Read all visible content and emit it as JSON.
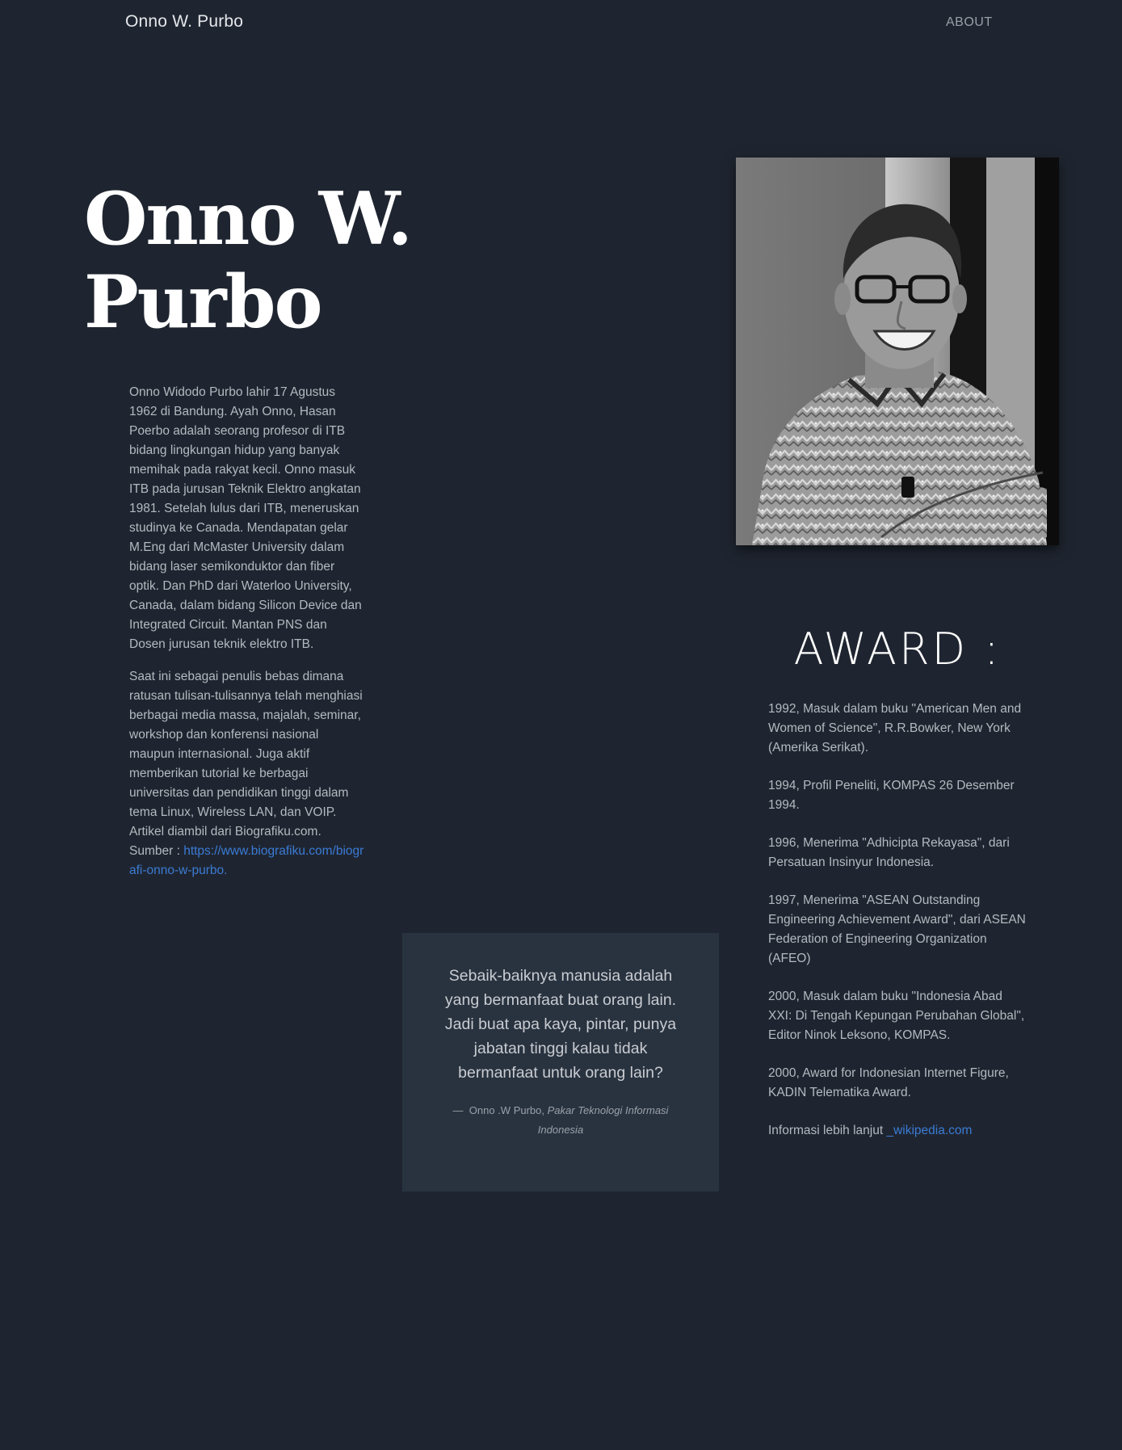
{
  "nav": {
    "brand": "Onno W. Purbo",
    "about": "ABOUT"
  },
  "hero": {
    "title_line1": "Onno W.",
    "title_line2": "Purbo"
  },
  "bio": {
    "paragraph1": "Onno Widodo Purbo lahir 17 Agustus 1962 di Bandung. Ayah Onno, Hasan Poerbo adalah seorang profesor di ITB bidang lingkungan hidup yang banyak memihak pada rakyat kecil. Onno masuk ITB pada jurusan Teknik Elektro angkatan 1981. Setelah lulus dari ITB, meneruskan studinya ke Canada. Mendapatan gelar M.Eng dari McMaster University dalam bidang laser semikonduktor dan fiber optik. Dan PhD dari Waterloo University, Canada, dalam bidang Silicon Device dan Integrated Circuit. Mantan PNS dan Dosen jurusan teknik elektro ITB.",
    "paragraph2": "Saat ini sebagai penulis bebas dimana ratusan tulisan-tulisannya telah menghiasi berbagai media massa, majalah, seminar, workshop dan konferensi nasional maupun internasional. Juga aktif memberikan tutorial ke berbagai universitas dan pendidikan tinggi dalam tema Linux, Wireless LAN, dan VOIP. Artikel diambil dari Biografiku.com. Sumber :",
    "source_link": "https://www.biografiku.com/biografi-onno-w-purbo."
  },
  "quote": {
    "text": "Sebaik-baiknya manusia adalah yang bermanfaat buat orang lain. Jadi buat apa kaya, pintar, punya jabatan tinggi kalau tidak bermanfaat untuk orang lain?",
    "dash": "—",
    "author": "Onno .W Purbo,",
    "role": "Pakar Teknologi Informasi Indonesia"
  },
  "award": {
    "title": "AWARD :",
    "items": [
      "1992, Masuk dalam buku \"American Men and Women of Science\", R.R.Bowker, New York (Amerika Serikat).",
      "1994, Profil Peneliti, KOMPAS 26 Desember 1994.",
      "1996, Menerima \"Adhicipta Rekayasa\", dari Persatuan Insinyur Indonesia.",
      "1997, Menerima \"ASEAN Outstanding Engineering Achievement Award\", dari ASEAN Federation of Engineering Organization (AFEO)",
      "2000, Masuk dalam buku \"Indonesia Abad XXI: Di Tengah Kepungan Perubahan Global\", Editor Ninok Leksono, KOMPAS.",
      "2000, Award for Indonesian Internet Figure, KADIN Telematika Award."
    ],
    "more_label": "Informasi lebih lanjut",
    "more_link": "_wikipedia.com"
  },
  "colors": {
    "background": "#1f2530",
    "quote_box": "#293340",
    "link": "#3a7bd5",
    "heading": "#ffffff"
  }
}
